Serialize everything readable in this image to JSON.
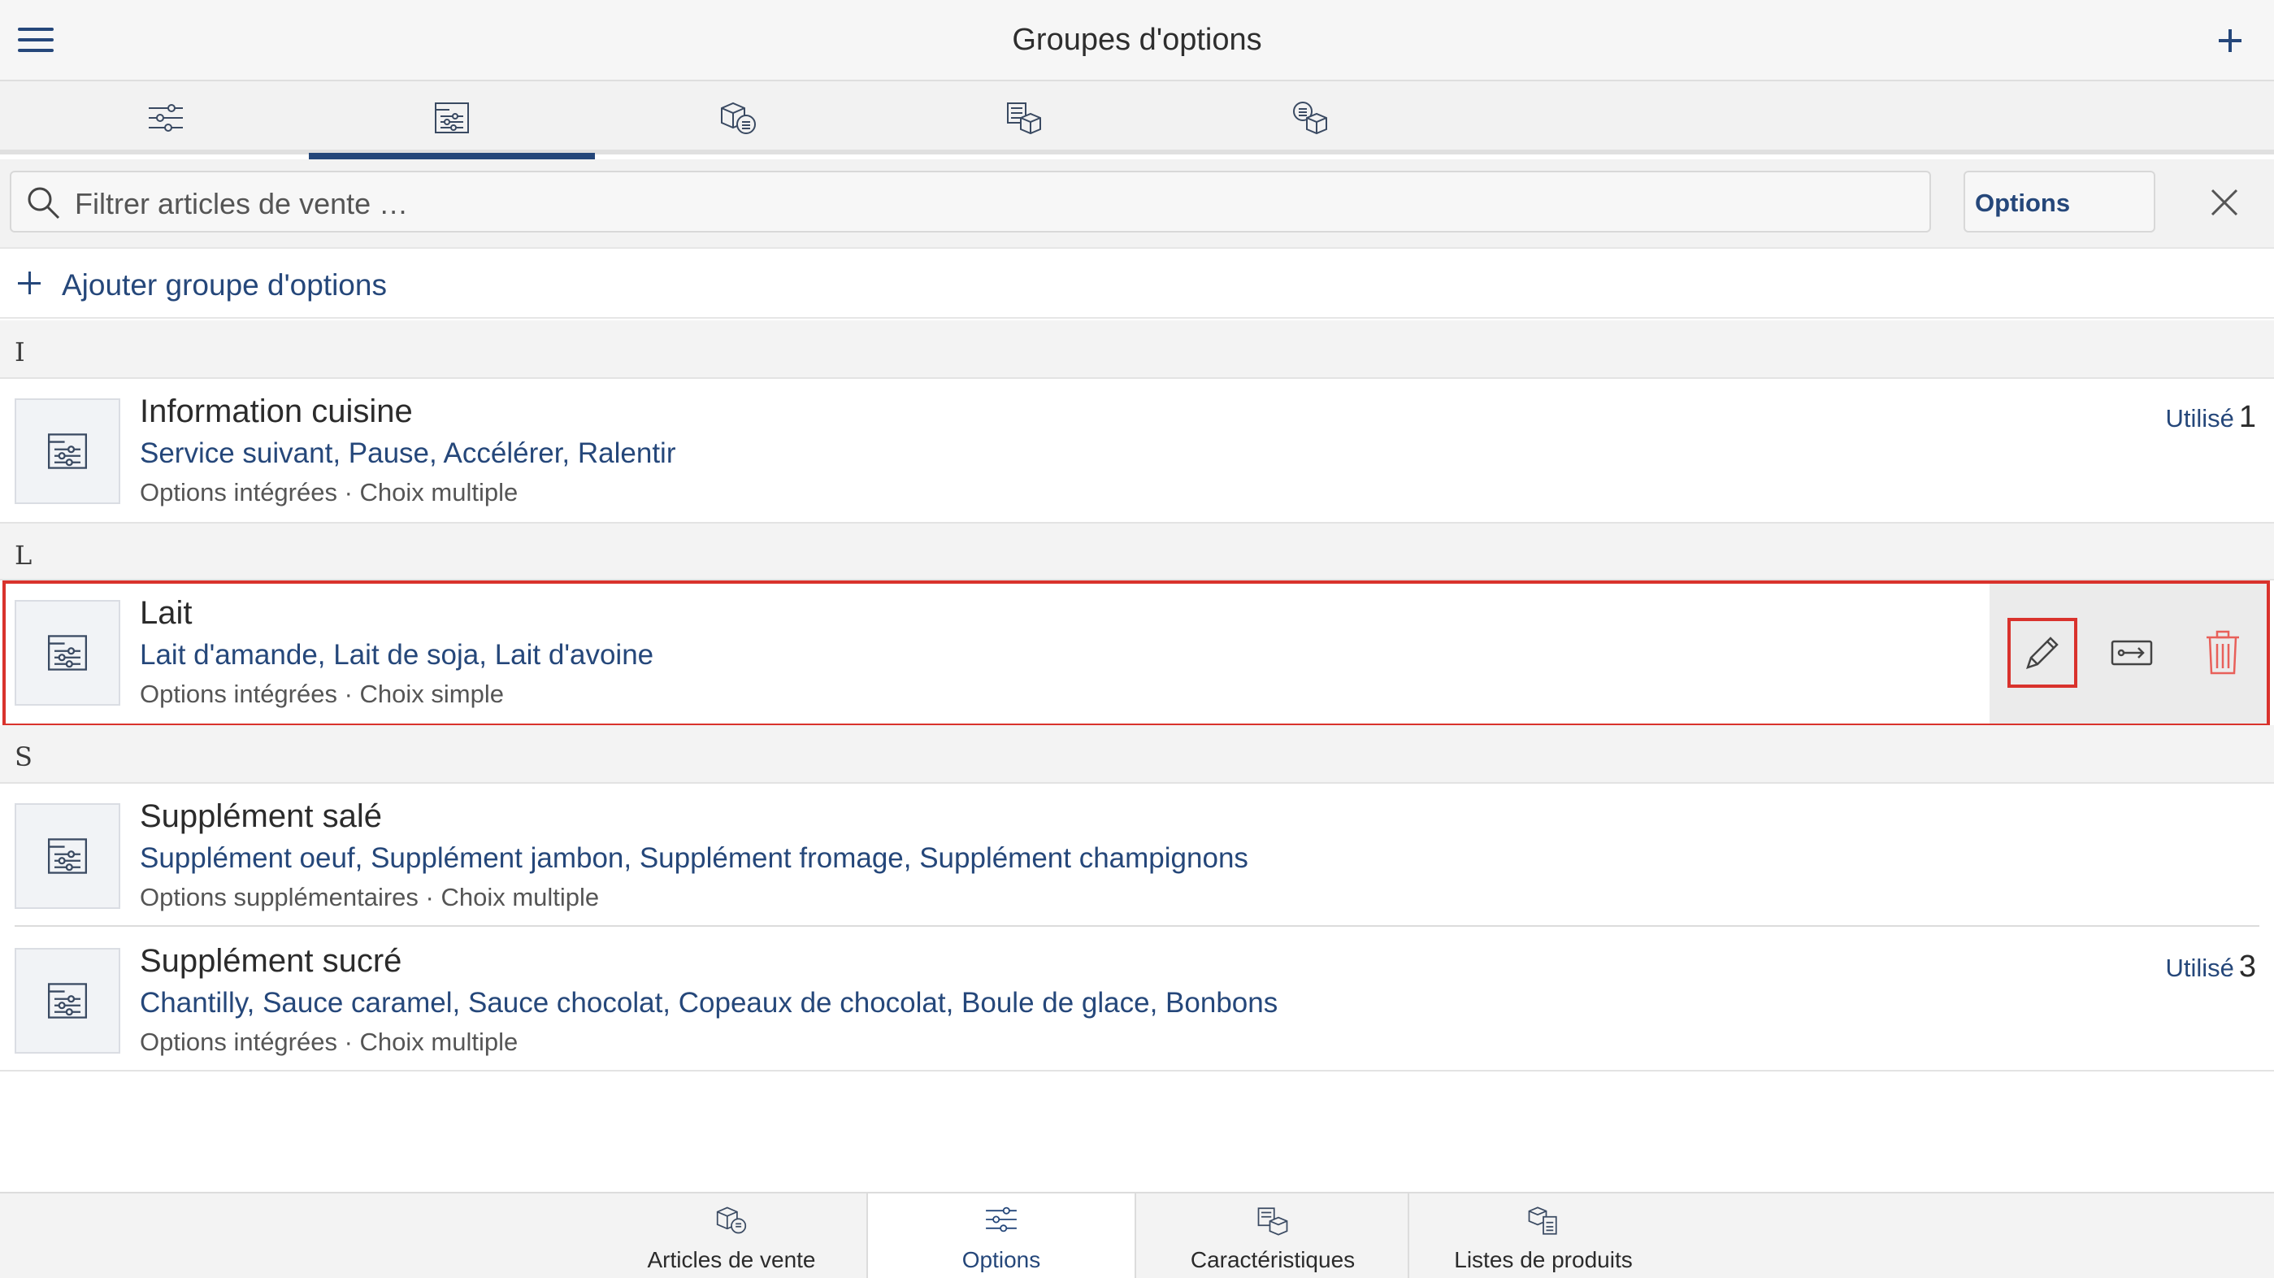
{
  "header": {
    "title": "Groupes d'options"
  },
  "top_tabs": [
    {
      "icon": "sliders-icon"
    },
    {
      "icon": "option-group-icon",
      "active": true
    },
    {
      "icon": "box-coin-icon"
    },
    {
      "icon": "box-list-icon"
    },
    {
      "icon": "coin-box-icon"
    }
  ],
  "search": {
    "placeholder": "Filtrer articles de vente …",
    "scope": "Options"
  },
  "add": {
    "label": "Ajouter groupe d'options"
  },
  "sections": {
    "i": "I",
    "l": "L",
    "s": "S"
  },
  "groups": [
    {
      "name": "Information cuisine",
      "items": "Service suivant, Pause, Accélérer, Ralentir",
      "meta": "Options intégrées · Choix multiple",
      "used_label": "Utilisé",
      "used_count": "1"
    },
    {
      "name": "Lait",
      "items": "Lait d'amande, Lait de soja, Lait d'avoine",
      "meta": "Options intégrées · Choix simple"
    },
    {
      "name": "Supplément salé",
      "items": "Supplément oeuf, Supplément jambon, Supplément fromage, Supplément champignons",
      "meta": "Options supplémentaires · Choix multiple"
    },
    {
      "name": "Supplément sucré",
      "items": "Chantilly, Sauce caramel, Sauce chocolat, Copeaux de chocolat, Boule de glace, Bonbons",
      "meta": "Options intégrées · Choix multiple",
      "used_label": "Utilisé",
      "used_count": "3"
    }
  ],
  "bottom_tabs": [
    {
      "label": "Articles de vente",
      "icon": "box-coin-icon"
    },
    {
      "label": "Options",
      "icon": "sliders-icon",
      "active": true
    },
    {
      "label": "Caractéristiques",
      "icon": "box-list-icon"
    },
    {
      "label": "Listes de produits",
      "icon": "box-doc-icon"
    }
  ],
  "colors": {
    "accent": "#25477a",
    "highlight": "#d9322c",
    "delete": "#e8605a"
  }
}
